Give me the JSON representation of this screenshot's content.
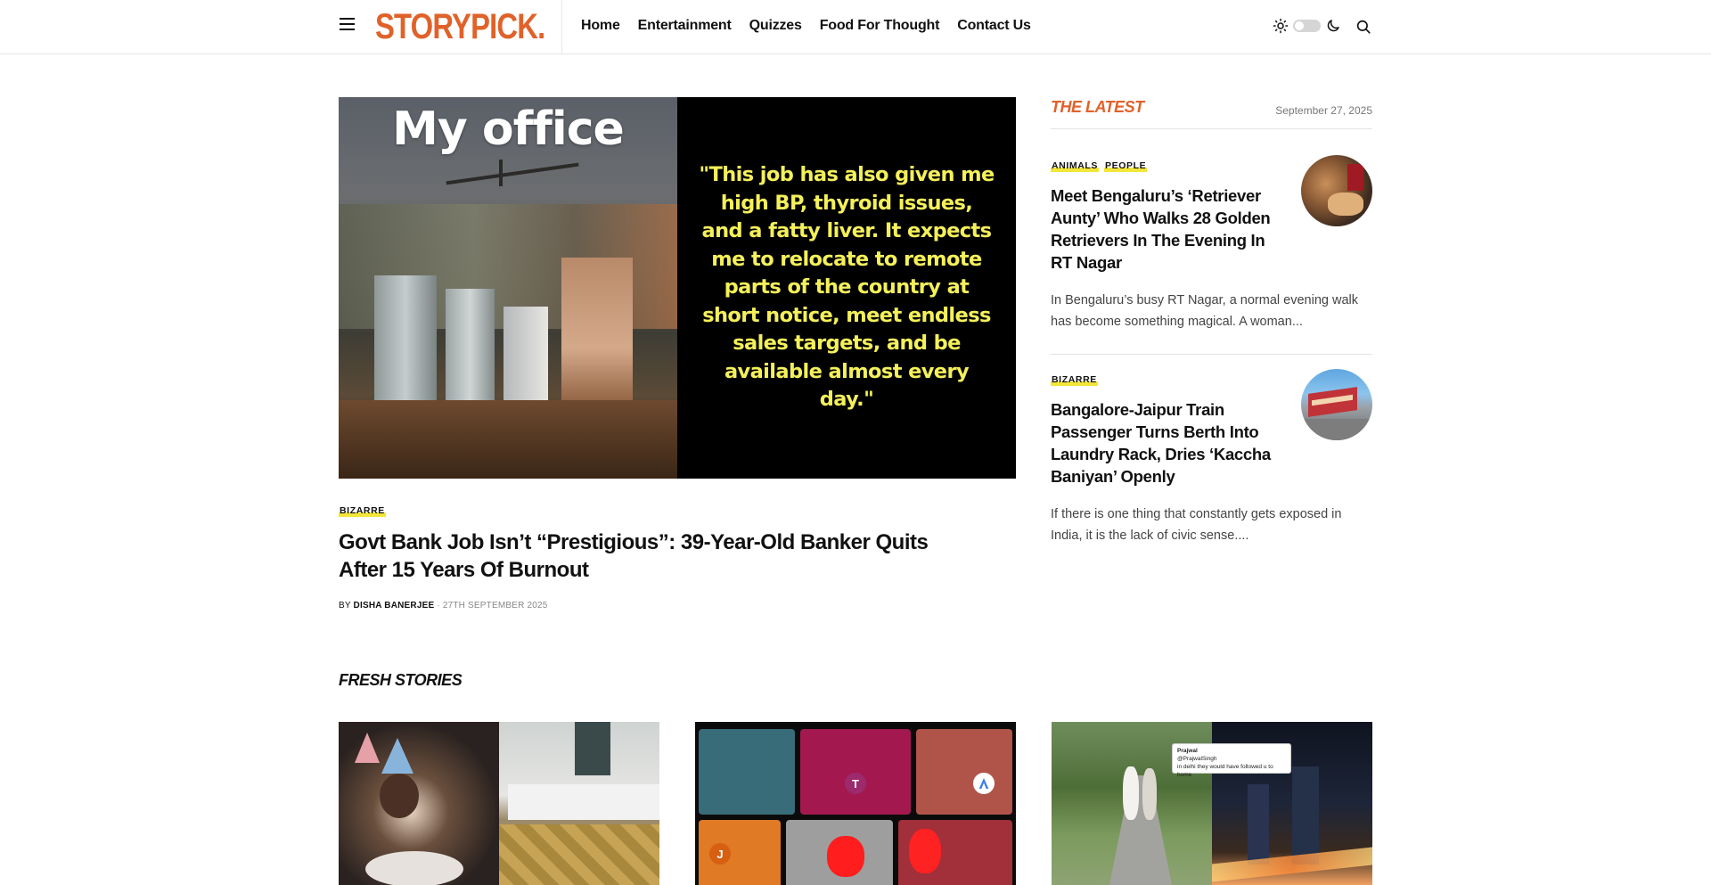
{
  "brand": {
    "logo": "STORYPICK.",
    "accent_color": "#e0622a",
    "tag_highlight": "#f3e63a"
  },
  "nav": {
    "items": [
      "Home",
      "Entertainment",
      "Quizzes",
      "Food For Thought",
      "Contact Us"
    ]
  },
  "header_icons": {
    "menu": "hamburger-menu-icon",
    "light": "sun-icon",
    "dark": "moon-icon",
    "search": "search-icon"
  },
  "hero": {
    "image_heading": "My office",
    "image_quote": "\"This job has also given me high BP, thyroid issues, and a fatty liver. It expects me to relocate to remote parts of the country at short notice, meet endless sales targets, and be available almost every day.\"",
    "tag": "BIZARRE",
    "title": "Govt Bank Job Isn’t “Prestigious”: 39-Year-Old Banker Quits After 15 Years Of Burnout",
    "by": "BY",
    "author": "DISHA BANERJEE",
    "date": "· 27TH SEPTEMBER 2025"
  },
  "latest": {
    "heading": "THE LATEST",
    "date": "September 27, 2025",
    "items": [
      {
        "tags": [
          "ANIMALS",
          "PEOPLE"
        ],
        "title": "Meet Bengaluru’s ‘Retriever Aunty’ Who Walks 28 Golden Retrievers In The Evening In RT Nagar",
        "excerpt": "In Bengaluru’s busy RT Nagar, a normal evening walk has become something magical. A woman..."
      },
      {
        "tags": [
          "BIZARRE"
        ],
        "title": "Bangalore-Jaipur Train Passenger Turns Berth Into Laundry Rack, Dries ‘Kaccha Baniyan’ Openly",
        "excerpt": "If there is one thing that constantly gets exposed in India, it is the lack of civic sense...."
      }
    ]
  },
  "fresh": {
    "heading": "FRESH STORIES",
    "card2_avatars": [
      "T",
      "J"
    ],
    "card3_tweet": {
      "name": "Prajwal",
      "handle": "@PrajwalSingh",
      "text": "in delhi they would have followed u to home"
    }
  }
}
